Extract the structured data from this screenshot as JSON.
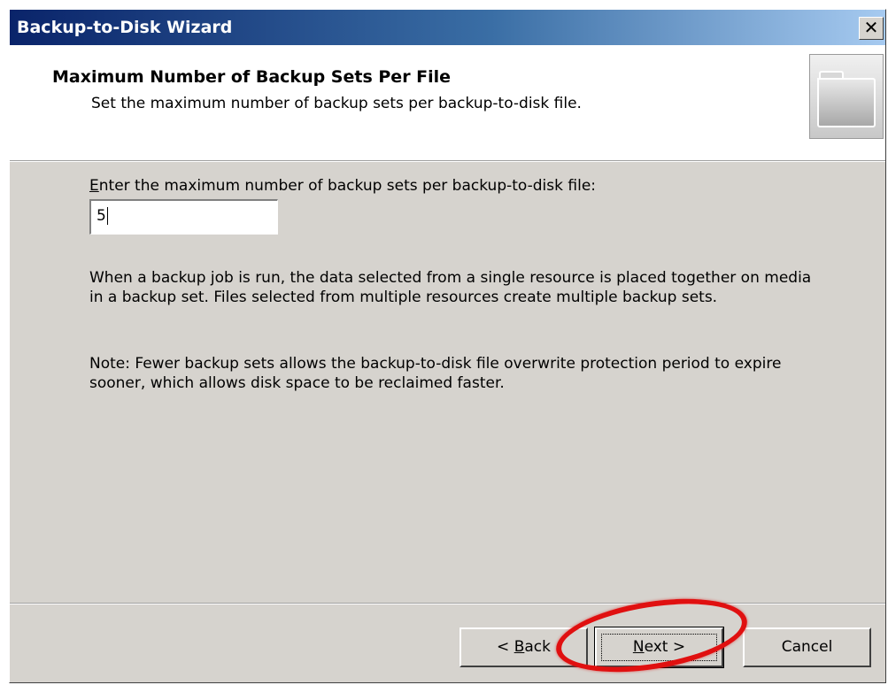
{
  "window": {
    "title": "Backup-to-Disk Wizard",
    "close_glyph": "✕"
  },
  "header": {
    "title": "Maximum Number of Backup Sets Per File",
    "subtitle": "Set the maximum number of backup sets per backup-to-disk file.",
    "icon": "folder-icon"
  },
  "field": {
    "label_accel": "E",
    "label_rest": "nter the maximum number of backup sets per backup-to-disk file:",
    "value": "5"
  },
  "body": {
    "paragraph1": "When a backup job is run, the data selected from a single resource is placed together on media in a backup set. Files selected from multiple resources create multiple backup sets.",
    "paragraph2": "Note: Fewer backup sets allows the backup-to-disk file overwrite protection period to expire sooner, which allows disk space to be reclaimed faster."
  },
  "buttons": {
    "back_prefix": "< ",
    "back_accel": "B",
    "back_rest": "ack",
    "next_accel": "N",
    "next_rest": "ext >",
    "cancel": "Cancel"
  },
  "colors": {
    "title_gradient_start": "#0a246a",
    "title_gradient_end": "#a6caf0",
    "dialog_face": "#d6d3ce",
    "annotation_circle": "#e01010"
  }
}
